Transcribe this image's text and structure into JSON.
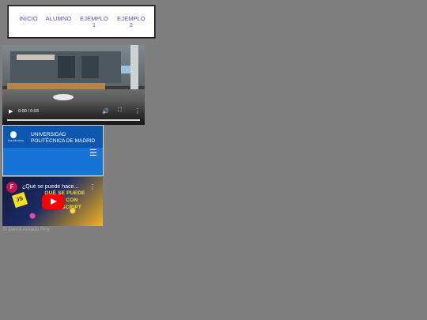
{
  "nav": {
    "items": [
      {
        "label": "INICIO"
      },
      {
        "label": "ALUMNO"
      },
      {
        "label": "EJEMPLO 1"
      },
      {
        "label": "EJEMPLO 2"
      }
    ]
  },
  "video": {
    "time": "0:00 / 0:03",
    "progress_fraction": 0
  },
  "upm": {
    "title_line1": "UNIVERSIDAD",
    "title_line2": "POLITÉCNICA DE MADRID",
    "logo_caption": "POLITÉCNICA"
  },
  "youtube": {
    "title": "¿Qué se puede hace...",
    "overlay_line1": "QUÉ SE PUEDE",
    "overlay_line2": "H...R CON",
    "overlay_line3": "JAVASCRIPT",
    "badge": "JS"
  },
  "footer": {
    "text": "© David Amado Roy"
  }
}
